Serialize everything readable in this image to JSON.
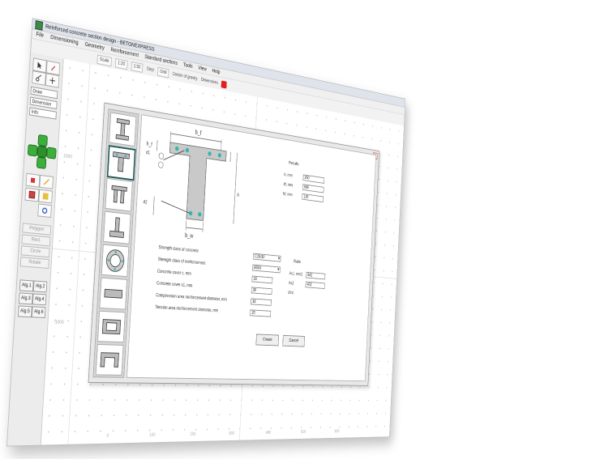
{
  "window": {
    "title": "Reinforced concrete section design - BETONEXPRESS",
    "menu": [
      "File",
      "Dimensioning",
      "Geometry",
      "Reinforcement",
      "Standard sections",
      "Tools",
      "View",
      "Help"
    ],
    "toolbar": {
      "buttons": [
        "Scale",
        "1:20",
        "1:50",
        "Grid"
      ],
      "labels": [
        "Step",
        "Center of gravity",
        "Dimensions"
      ],
      "stop_color": "#e02020"
    }
  },
  "palette": {
    "fields": [
      "Draw",
      "Dimension",
      "Info"
    ],
    "gray_buttons": [
      "Polygon",
      "Rect.",
      "Circle",
      "Rotate"
    ],
    "alg_buttons": [
      "Alg.1",
      "Alg.2",
      "Alg.3",
      "Alg.4",
      "Alg.5",
      "Alg.6"
    ],
    "dpad_color": "#3cae3c"
  },
  "canvas": {
    "ruler": [
      "-1000",
      "1000",
      "0",
      "100",
      "200",
      "300",
      "400",
      "500",
      "600"
    ]
  },
  "dialog": {
    "close_label": "x",
    "section_labels": {
      "bf": "b_f",
      "bw": "b_w",
      "hf": "h_f",
      "h": "h",
      "d1": "d1",
      "d2": "d2"
    },
    "right_group_title": "Results",
    "right_fields": [
      {
        "label": "b, mm",
        "value": "200"
      },
      {
        "label": "bf, mm",
        "value": "600"
      },
      {
        "label": "hf, mm",
        "value": "120"
      }
    ],
    "form": [
      {
        "label": "Strength class of concrete",
        "value": "C25/30",
        "select": true
      },
      {
        "label": "Strength class of reinforcement",
        "value": "B500",
        "select": true
      },
      {
        "label": "Concrete cover c, mm",
        "value": "30"
      },
      {
        "label": "Concrete cover c1, mm",
        "value": "30"
      },
      {
        "label": "Compression area reinforcement diameter, mm",
        "value": "16"
      },
      {
        "label": "Tension area reinforcement diameter, mm",
        "value": "20"
      }
    ],
    "side_group_title": "Ratio",
    "side_fields": [
      {
        "label": "As1, mm2",
        "value": "942"
      },
      {
        "label": "As2",
        "value": "402"
      },
      {
        "label": "Mrd",
        "value": ""
      }
    ],
    "buttons": {
      "create": "Create",
      "cancel": "Cancel"
    }
  }
}
